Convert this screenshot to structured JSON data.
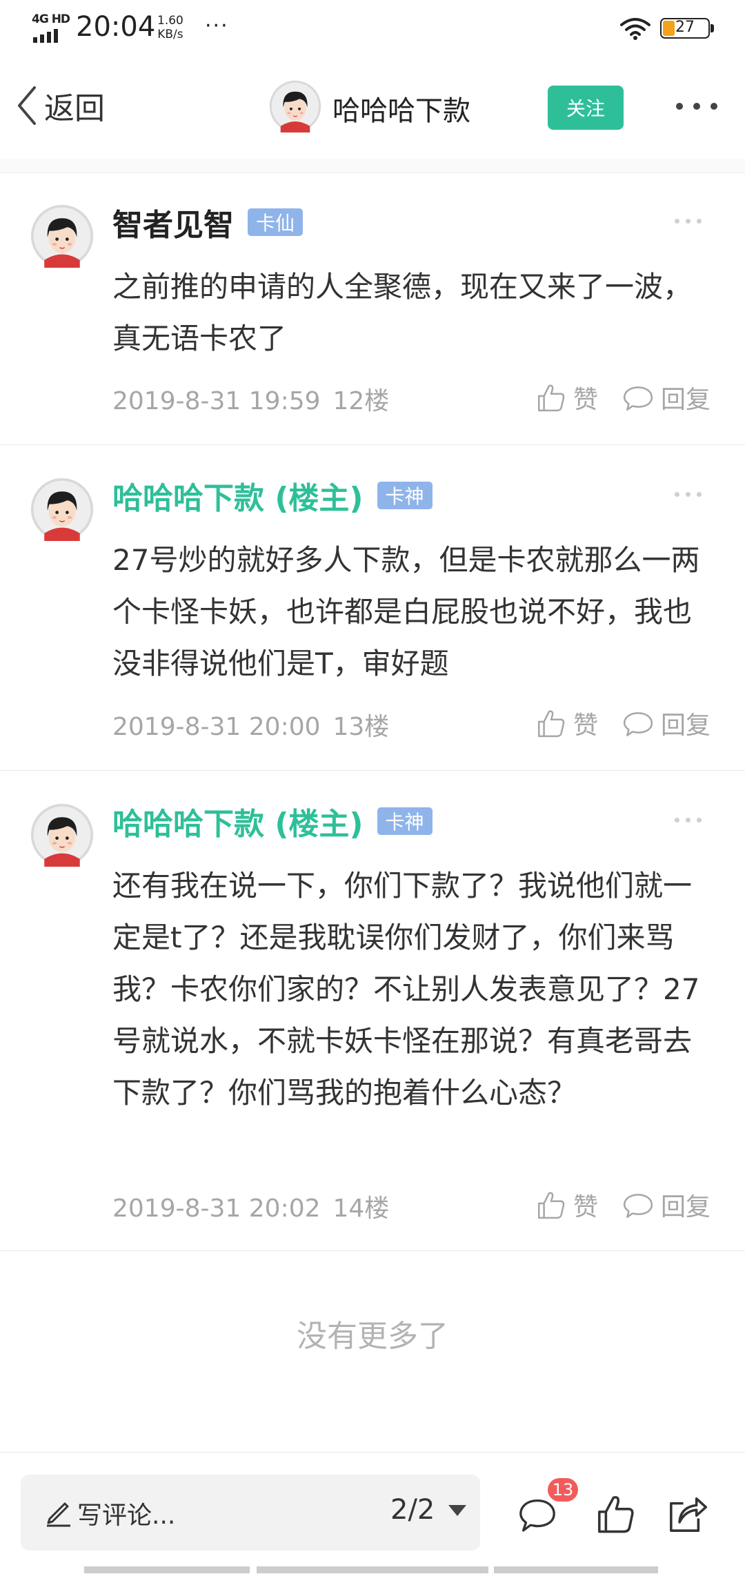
{
  "status_bar": {
    "network": "4G HD",
    "time": "20:04",
    "speed_value": "1.60",
    "speed_unit": "KB/s",
    "more": "···",
    "battery_level": "27",
    "battery_fraction": 0.27
  },
  "nav": {
    "back_label": "返回",
    "author_name": "哈哈哈下款",
    "follow_label": "关注"
  },
  "posts": [
    {
      "author": "智者见智",
      "is_op": false,
      "badge": "卡仙",
      "body": "之前推的申请的人全聚德，现在又来了一波，真无语卡农了",
      "date": "2019-8-31 19:59",
      "floor": "12楼",
      "like_label": "赞",
      "reply_label": "回复"
    },
    {
      "author": "哈哈哈下款 (楼主)",
      "is_op": true,
      "badge": "卡神",
      "body": "27号炒的就好多人下款，但是卡农就那么一两个卡怪卡妖，也许都是白屁股也说不好，我也没非得说他们是T，审好题",
      "date": "2019-8-31 20:00",
      "floor": "13楼",
      "like_label": "赞",
      "reply_label": "回复"
    },
    {
      "author": "哈哈哈下款 (楼主)",
      "is_op": true,
      "badge": "卡神",
      "body": "还有我在说一下，你们下款了？我说他们就一定是t了？还是我耽误你们发财了，你们来骂我？卡农你们家的？不让别人发表意见了？27号就说水，不就卡妖卡怪在那说？有真老哥去下款了？你们骂我的抱着什么心态？",
      "date": "2019-8-31 20:02",
      "floor": "14楼",
      "like_label": "赞",
      "reply_label": "回复"
    }
  ],
  "end_text": "没有更多了",
  "bottom": {
    "comment_placeholder": "写评论...",
    "page_indicator": "2/2",
    "comment_count": "13"
  },
  "colors": {
    "accent": "#2ebf99",
    "badge": "#8fb4ea",
    "count_badge": "#f25b5b",
    "meta_text": "#a6a6a6"
  },
  "icons": [
    "chevron-left-icon",
    "more-icon",
    "thumbs-up-icon",
    "comment-bubble-icon",
    "pencil-icon",
    "caret-down-icon",
    "share-icon",
    "wifi-icon",
    "battery-icon",
    "signal-icon"
  ]
}
